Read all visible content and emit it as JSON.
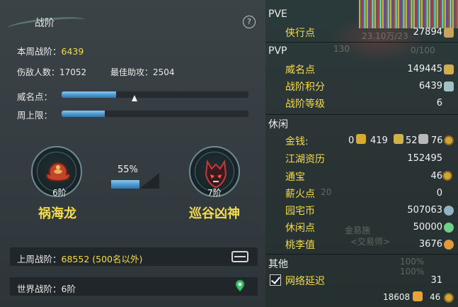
{
  "left": {
    "title": "战阶",
    "help": "?",
    "weekly_label": "本周战阶：",
    "weekly_value": "6439",
    "injured_label": "伤敌人数：",
    "injured_value": "17052",
    "assist_label": "最佳助攻：",
    "assist_value": "2504",
    "fame_label": "威名点：",
    "fame_progress": 0.29,
    "cap_label": "周上限：",
    "cap_progress": 0.23,
    "progress_percent": "55%",
    "current_rank": {
      "tier": "6阶",
      "name": "祸海龙"
    },
    "next_rank": {
      "tier": "7阶",
      "name": "巡谷凶神"
    },
    "last_week_label": "上周战阶：",
    "last_week_value": "68552 (500名以外)",
    "world_label": "世界战阶：",
    "world_value": "6阶",
    "icons": [
      "chest-icon",
      "map-pin-icon",
      "dragon-emblem-icon",
      "demon-mask-emblem-icon"
    ]
  },
  "right": {
    "pve_header": "PVE",
    "pve_rows": [
      {
        "label": "侠行点",
        "value": "27894"
      }
    ],
    "pvp_header": "PVP",
    "pvp_rows": [
      {
        "label": "威名点",
        "value": "149445"
      },
      {
        "label": "战阶积分",
        "value": "6439"
      },
      {
        "label": "战阶等级",
        "value": "6"
      }
    ],
    "leisure_header": "休闲",
    "money_label": "金钱:",
    "money_gold": "0",
    "money_silver": "419",
    "money_copper": "52",
    "money_iron": "76",
    "leisure_rows": [
      {
        "label": "江湖资历",
        "value": "152495"
      },
      {
        "label": "通宝",
        "value": "46"
      },
      {
        "label": "薪火点",
        "value": "0"
      },
      {
        "label": "园宅币",
        "value": "507063"
      },
      {
        "label": "休闲点",
        "value": "50000"
      },
      {
        "label": "桃李值",
        "value": "3676"
      }
    ],
    "other_header": "其他",
    "network_label": "网络延迟",
    "network_value": "31",
    "footer_left": "18608",
    "footer_right": "46",
    "faint_bg": {
      "a": "23.10万/23",
      "b": "130",
      "c": "0/100",
      "d": "20",
      "e": "金易施",
      "f": "<交易师>",
      "g": "100%",
      "h": "100%"
    }
  }
}
